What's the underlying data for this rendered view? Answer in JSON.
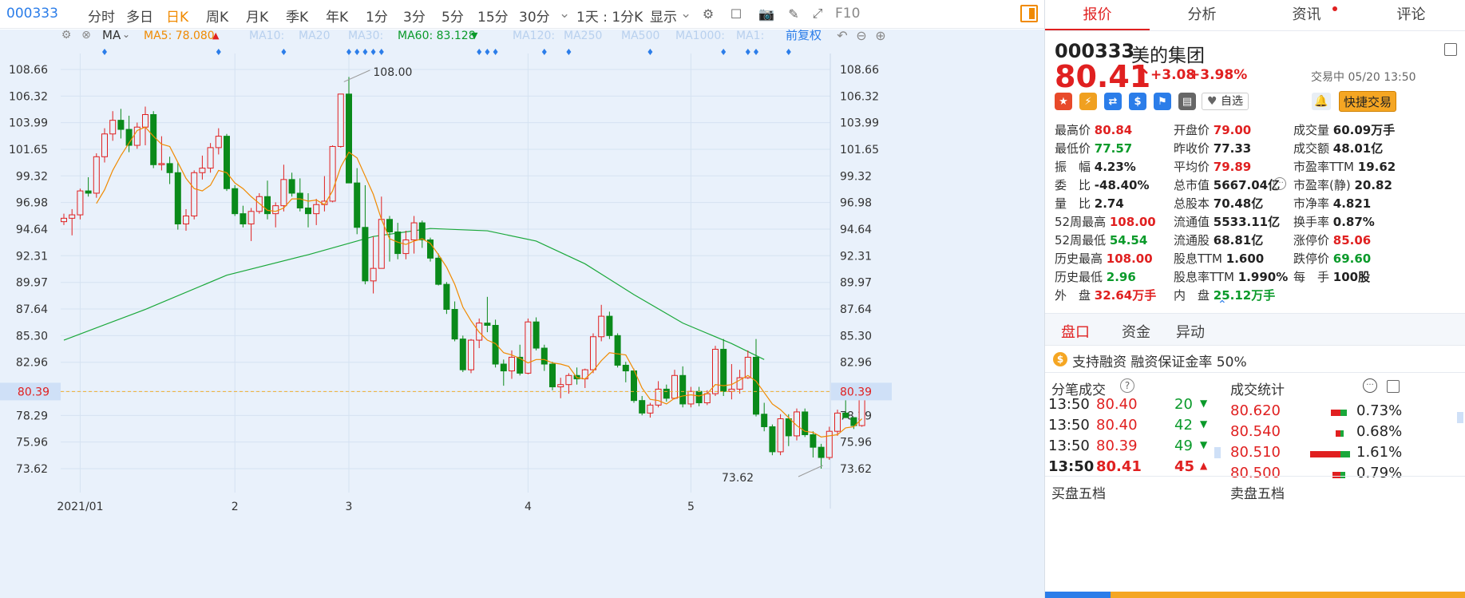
{
  "toolbar": {
    "code": "000333",
    "items": [
      "分时",
      "多日",
      "日K",
      "周K",
      "月K",
      "季K",
      "年K",
      "1分",
      "3分",
      "5分",
      "15分",
      "30分"
    ],
    "active": "日K",
    "dropdown": "1天 : 1分K",
    "display": "显示",
    "f10": "F10"
  },
  "ma_bar": {
    "type": "MA",
    "ma5": "MA5: 78.080",
    "ma10": "MA10:",
    "ma20": "MA20",
    "ma30": "MA30:",
    "ma60": "MA60: 83.128",
    "ma120": "MA120:",
    "ma250": "MA250",
    "ma500": "MA500",
    "ma1000": "MA1000:",
    "ma1": "MA1:",
    "adjust": "前复权",
    "colors": {
      "ma5": "#f08a00",
      "ma60": "#0a9a2a",
      "faded": "#b8d0ee"
    }
  },
  "chart_data": {
    "type": "candlestick",
    "y_ticks": [
      "108.66",
      "106.32",
      "103.99",
      "101.65",
      "99.32",
      "96.98",
      "94.64",
      "92.31",
      "89.97",
      "87.64",
      "85.30",
      "82.96",
      "80.39",
      "78.29",
      "75.96",
      "73.62"
    ],
    "ylim": [
      72,
      110
    ],
    "x_labels": [
      {
        "label": "2021/01",
        "index": 2
      },
      {
        "label": "2",
        "index": 21
      },
      {
        "label": "3",
        "index": 35
      },
      {
        "label": "4",
        "index": 57
      },
      {
        "label": "5",
        "index": 77
      }
    ],
    "current_price": 80.39,
    "annotations": {
      "high": "108.00",
      "low": "73.62"
    },
    "ohlc": [
      [
        95.3,
        96.0,
        95.0,
        95.6
      ],
      [
        95.6,
        96.4,
        94.1,
        95.9
      ],
      [
        95.9,
        98.2,
        95.5,
        98.0
      ],
      [
        98.0,
        99.2,
        97.5,
        97.8
      ],
      [
        97.8,
        101.3,
        97.4,
        101.0
      ],
      [
        101.0,
        103.5,
        100.5,
        103.0
      ],
      [
        103.0,
        105.0,
        102.4,
        104.2
      ],
      [
        104.2,
        105.2,
        102.6,
        103.4
      ],
      [
        103.4,
        104.6,
        101.4,
        102.0
      ],
      [
        102.0,
        104.0,
        101.7,
        103.6
      ],
      [
        103.6,
        105.4,
        102.0,
        104.7
      ],
      [
        104.7,
        105.0,
        100.0,
        100.3
      ],
      [
        100.3,
        102.8,
        99.8,
        100.4
      ],
      [
        100.4,
        101.0,
        98.6,
        99.6
      ],
      [
        99.6,
        100.5,
        94.6,
        95.1
      ],
      [
        95.1,
        96.4,
        94.5,
        95.8
      ],
      [
        95.8,
        99.8,
        95.5,
        99.6
      ],
      [
        99.6,
        101.1,
        99.0,
        100.0
      ],
      [
        100.0,
        102.2,
        99.6,
        101.8
      ],
      [
        101.8,
        103.5,
        101.2,
        102.8
      ],
      [
        102.8,
        103.0,
        98.0,
        98.2
      ],
      [
        98.2,
        98.5,
        95.8,
        96.0
      ],
      [
        96.0,
        96.7,
        94.8,
        95.1
      ],
      [
        95.1,
        96.5,
        93.6,
        96.2
      ],
      [
        96.2,
        97.8,
        96.0,
        97.5
      ],
      [
        97.5,
        98.9,
        95.5,
        96.0
      ],
      [
        96.0,
        97.0,
        94.8,
        96.7
      ],
      [
        96.7,
        100.3,
        96.2,
        99.0
      ],
      [
        99.0,
        99.6,
        97.5,
        97.8
      ],
      [
        97.8,
        99.1,
        96.2,
        96.5
      ],
      [
        96.5,
        97.8,
        94.8,
        96.0
      ],
      [
        96.0,
        97.3,
        95.0,
        96.8
      ],
      [
        96.8,
        99.3,
        96.2,
        97.1
      ],
      [
        97.1,
        102.0,
        97.0,
        101.9
      ],
      [
        101.9,
        106.5,
        101.8,
        106.5
      ],
      [
        106.5,
        108.0,
        98.7,
        98.7
      ],
      [
        98.7,
        100.0,
        94.2,
        94.8
      ],
      [
        94.8,
        98.5,
        89.8,
        90.1
      ],
      [
        90.1,
        94.0,
        89.0,
        91.2
      ],
      [
        91.2,
        97.5,
        94.0,
        95.5
      ],
      [
        95.5,
        95.8,
        91.8,
        94.4
      ],
      [
        94.4,
        95.2,
        92.0,
        92.5
      ],
      [
        92.5,
        94.5,
        92.0,
        93.7
      ],
      [
        93.7,
        95.8,
        92.5,
        95.2
      ],
      [
        95.2,
        95.4,
        93.0,
        93.7
      ],
      [
        93.7,
        93.9,
        91.8,
        92.1
      ],
      [
        92.1,
        92.5,
        89.7,
        89.8
      ],
      [
        89.8,
        90.0,
        87.2,
        87.6
      ],
      [
        87.6,
        88.3,
        84.8,
        85.0
      ],
      [
        85.0,
        85.3,
        82.1,
        82.3
      ],
      [
        82.3,
        85.0,
        82.0,
        84.9
      ],
      [
        84.9,
        86.8,
        84.2,
        86.4
      ],
      [
        86.4,
        88.7,
        85.6,
        86.2
      ],
      [
        86.2,
        86.7,
        82.5,
        82.8
      ],
      [
        82.8,
        83.2,
        80.9,
        82.2
      ],
      [
        82.2,
        84.0,
        81.5,
        83.4
      ],
      [
        83.4,
        84.5,
        81.8,
        82.0
      ],
      [
        82.0,
        86.8,
        81.9,
        86.5
      ],
      [
        86.5,
        86.9,
        84.0,
        84.2
      ],
      [
        84.2,
        84.5,
        82.2,
        82.8
      ],
      [
        82.8,
        83.0,
        80.5,
        80.8
      ],
      [
        80.8,
        81.6,
        79.8,
        81.0
      ],
      [
        81.0,
        82.0,
        80.2,
        81.8
      ],
      [
        81.8,
        82.5,
        81.0,
        81.5
      ],
      [
        81.5,
        82.4,
        80.7,
        82.3
      ],
      [
        82.3,
        85.5,
        82.0,
        85.2
      ],
      [
        85.2,
        88.0,
        84.8,
        87.0
      ],
      [
        87.0,
        87.4,
        85.0,
        85.3
      ],
      [
        85.3,
        85.5,
        82.5,
        82.7
      ],
      [
        82.7,
        83.0,
        81.2,
        82.2
      ],
      [
        82.2,
        82.4,
        79.4,
        79.6
      ],
      [
        79.6,
        80.0,
        78.3,
        78.5
      ],
      [
        78.5,
        79.4,
        78.1,
        79.2
      ],
      [
        79.2,
        81.3,
        79.0,
        80.6
      ],
      [
        80.6,
        81.0,
        79.5,
        79.8
      ],
      [
        79.8,
        82.3,
        79.7,
        81.8
      ],
      [
        81.8,
        82.6,
        79.0,
        79.3
      ],
      [
        79.3,
        80.8,
        79.0,
        80.4
      ],
      [
        80.4,
        80.8,
        79.1,
        79.4
      ],
      [
        79.4,
        80.5,
        79.2,
        80.2
      ],
      [
        80.2,
        84.4,
        80.0,
        84.1
      ],
      [
        84.1,
        85.0,
        80.0,
        80.4
      ],
      [
        80.4,
        82.8,
        79.7,
        80.6
      ],
      [
        80.6,
        82.3,
        80.2,
        81.6
      ],
      [
        81.6,
        84.0,
        81.5,
        83.4
      ],
      [
        83.4,
        85.0,
        78.2,
        78.4
      ],
      [
        78.4,
        79.4,
        76.9,
        77.3
      ],
      [
        77.3,
        77.5,
        74.8,
        75.1
      ],
      [
        75.1,
        78.4,
        74.8,
        78.0
      ],
      [
        78.0,
        78.4,
        75.6,
        76.5
      ],
      [
        76.5,
        78.9,
        76.1,
        78.6
      ],
      [
        78.6,
        78.9,
        76.4,
        76.6
      ],
      [
        76.6,
        76.9,
        74.6,
        75.5
      ],
      [
        75.5,
        75.8,
        73.62,
        74.6
      ],
      [
        74.6,
        77.3,
        74.4,
        76.9
      ],
      [
        76.9,
        78.8,
        76.5,
        78.5
      ],
      [
        78.5,
        80.1,
        78.2,
        78.1
      ],
      [
        78.1,
        77.6,
        77.1,
        77.4
      ],
      [
        77.4,
        81.0,
        77.3,
        80.39
      ]
    ],
    "ma5": [
      null,
      null,
      null,
      null,
      96.9,
      98.1,
      99.8,
      101.1,
      102.2,
      103.3,
      103.6,
      102.8,
      102.1,
      101.9,
      100.5,
      99.1,
      98.2,
      98.0,
      98.5,
      99.8,
      99.6,
      98.7,
      98.2,
      97.5,
      96.9,
      96.3,
      96.2,
      96.5,
      97.3,
      97.3,
      97.1,
      97.2,
      96.8,
      98.0,
      100.1,
      101.4,
      100.9,
      99.3,
      97.7,
      95.5,
      93.8,
      93.5,
      93.3,
      93.6,
      93.8,
      93.4,
      92.4,
      91.3,
      89.8,
      87.8,
      86.6,
      85.6,
      84.9,
      84.6,
      83.8,
      83.6,
      83.3,
      82.9,
      83.2,
      83.2,
      82.9,
      82.8,
      82.6,
      81.6,
      81.5,
      82.2,
      83.1,
      83.8,
      83.7,
      83.6,
      82.3,
      80.7,
      79.7,
      79.6,
      79.3,
      79.8,
      80.0,
      80.1,
      80.0,
      80.2,
      81.0,
      80.9,
      81.0,
      81.4,
      81.8,
      81.3,
      80.3,
      79.3,
      78.8,
      78.1,
      77.4,
      76.9,
      76.8,
      76.4,
      76.5,
      76.6,
      77.2,
      77.3,
      78.0
    ],
    "ma60_start": 48.0,
    "ma60_points": [
      [
        0,
        84.9
      ],
      [
        10,
        87.6
      ],
      [
        20,
        90.6
      ],
      [
        30,
        92.4
      ],
      [
        38,
        94.0
      ],
      [
        45,
        94.7
      ],
      [
        52,
        94.5
      ],
      [
        58,
        93.6
      ],
      [
        64,
        91.6
      ],
      [
        70,
        88.9
      ],
      [
        76,
        86.4
      ],
      [
        82,
        84.6
      ],
      [
        86,
        83.2
      ]
    ]
  },
  "quote": {
    "code": "000333",
    "name": "美的集团",
    "price": "80.41",
    "arrow": "↑",
    "change": "+3.08",
    "change_pct": "+3.98%",
    "status": "交易中 05/20 13:50",
    "zixuan": "自选",
    "quick_trade": "快捷交易",
    "fields": [
      [
        "最高价",
        "80.84",
        "red"
      ],
      [
        "开盘价",
        "79.00",
        "red"
      ],
      [
        "成交量",
        "60.09万手",
        "blk"
      ],
      [
        "最低价",
        "77.57",
        "green"
      ],
      [
        "昨收价",
        "77.33",
        "blk"
      ],
      [
        "成交额",
        "48.01亿",
        "blk"
      ],
      [
        "振　幅",
        "4.23%",
        "blk"
      ],
      [
        "平均价",
        "79.89",
        "red"
      ],
      [
        "市盈率TTM",
        "19.62",
        "blk"
      ],
      [
        "委　比",
        "-48.40%",
        "blk"
      ],
      [
        "总市值",
        "5667.04亿",
        "blk"
      ],
      [
        "市盈率(静)",
        "20.82",
        "blk"
      ],
      [
        "量　比",
        "2.74",
        "blk"
      ],
      [
        "总股本",
        "70.48亿",
        "blk"
      ],
      [
        "市净率",
        "4.821",
        "blk"
      ],
      [
        "52周最高",
        "108.00",
        "red"
      ],
      [
        "流通值",
        "5533.11亿",
        "blk"
      ],
      [
        "换手率",
        "0.87%",
        "blk"
      ],
      [
        "52周最低",
        "54.54",
        "green"
      ],
      [
        "流通股",
        "68.81亿",
        "blk"
      ],
      [
        "涨停价",
        "85.06",
        "red"
      ],
      [
        "历史最高",
        "108.00",
        "red"
      ],
      [
        "股息TTM",
        "1.600",
        "blk"
      ],
      [
        "跌停价",
        "69.60",
        "green"
      ],
      [
        "历史最低",
        "2.96",
        "green"
      ],
      [
        "股息率TTM",
        "1.990%",
        "blk"
      ],
      [
        "每　手",
        "100股",
        "blk"
      ],
      [
        "外　盘",
        "32.64万手",
        "red"
      ],
      [
        "内　盘",
        "25.12万手",
        "green"
      ],
      [
        "",
        ""
      ]
    ]
  },
  "rtabs": [
    "报价",
    "分析",
    "资讯",
    "评论"
  ],
  "sub_tabs": [
    "盘口",
    "资金",
    "异动"
  ],
  "margin_text": "支持融资 融资保证金率 50%",
  "trades_title": "分笔成交",
  "stats_title": "成交统计",
  "trades": [
    [
      "13:50",
      "80.40",
      "20",
      "green"
    ],
    [
      "13:50",
      "80.40",
      "42",
      "green"
    ],
    [
      "13:50",
      "80.39",
      "49",
      "green"
    ],
    [
      "13:50",
      "80.41",
      "45",
      "red"
    ]
  ],
  "stats": [
    [
      "80.620",
      "0.73%",
      12,
      8
    ],
    [
      "80.540",
      "0.68%",
      6,
      4
    ],
    [
      "80.510",
      "1.61%",
      38,
      12
    ],
    [
      "80.500",
      "0.79%",
      10,
      6
    ]
  ],
  "buy5": "买盘五档",
  "sell5": "卖盘五档"
}
